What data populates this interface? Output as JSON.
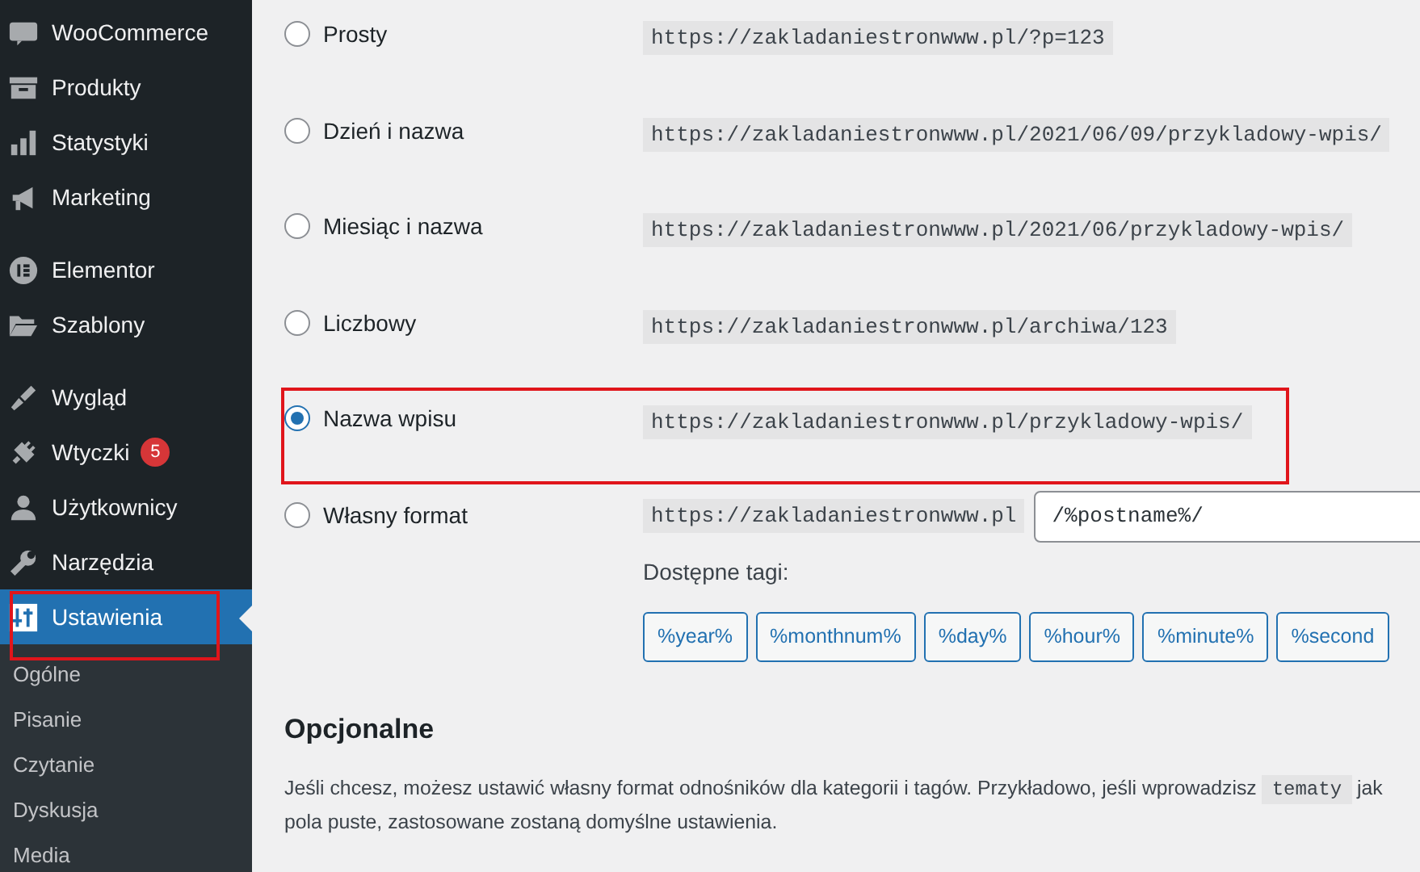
{
  "sidebar": {
    "menu_groups": [
      [
        {
          "label": "WooCommerce",
          "selected": false,
          "highlighted": false
        },
        {
          "label": "Produkty",
          "selected": false,
          "highlighted": false
        },
        {
          "label": "Statystyki",
          "selected": false,
          "highlighted": false
        },
        {
          "label": "Marketing",
          "selected": false,
          "highlighted": false
        }
      ],
      [
        {
          "label": "Elementor",
          "selected": false,
          "highlighted": false
        },
        {
          "label": "Szablony",
          "selected": false,
          "highlighted": false
        }
      ],
      [
        {
          "label": "Wygląd",
          "selected": false,
          "highlighted": false
        },
        {
          "label": "Wtyczki",
          "badge": "5",
          "selected": false,
          "highlighted": false
        },
        {
          "label": "Użytkownicy",
          "selected": false,
          "highlighted": false
        },
        {
          "label": "Narzędzia",
          "selected": false,
          "highlighted": false
        },
        {
          "label": "Ustawienia",
          "selected": true,
          "highlighted": true
        }
      ]
    ],
    "submenu": [
      {
        "label": "Ogólne"
      },
      {
        "label": "Pisanie"
      },
      {
        "label": "Czytanie"
      },
      {
        "label": "Dyskusja"
      },
      {
        "label": "Media"
      }
    ]
  },
  "permalink_options": [
    {
      "kind": "preset",
      "label": "Prosty",
      "url": "https://zakladaniestronwww.pl/?p=123",
      "selected": false,
      "highlighted": false
    },
    {
      "kind": "preset",
      "label": "Dzień i nazwa",
      "url": "https://zakladaniestronwww.pl/2021/06/09/przykladowy-wpis/",
      "selected": false,
      "highlighted": false
    },
    {
      "kind": "preset",
      "label": "Miesiąc i nazwa",
      "url": "https://zakladaniestronwww.pl/2021/06/przykladowy-wpis/",
      "selected": false,
      "highlighted": false
    },
    {
      "kind": "preset",
      "label": "Liczbowy",
      "url": "https://zakladaniestronwww.pl/archiwa/123",
      "selected": false,
      "highlighted": false
    },
    {
      "kind": "preset",
      "label": "Nazwa wpisu",
      "url": "https://zakladaniestronwww.pl/przykladowy-wpis/",
      "selected": true,
      "highlighted": true
    },
    {
      "kind": "custom",
      "label": "Własny format",
      "url": "https://zakladaniestronwww.pl",
      "value": "/%postname%/",
      "tags_label": "Dostępne tagi:",
      "tags": [
        "%year%",
        "%monthnum%",
        "%day%",
        "%hour%",
        "%minute%",
        "%second"
      ],
      "selected": false,
      "highlighted": false
    }
  ],
  "optional": {
    "heading": "Opcjonalne",
    "lines": [
      {
        "text": "Jeśli chcesz, możesz ustawić własny format odnośników dla kategorii i tagów. Przykładowo, jeśli wprowadzisz ",
        "code": "tematy",
        "after": " jak"
      },
      {
        "text": "pola puste, zastosowane zostaną domyślne ustawienia."
      }
    ]
  }
}
